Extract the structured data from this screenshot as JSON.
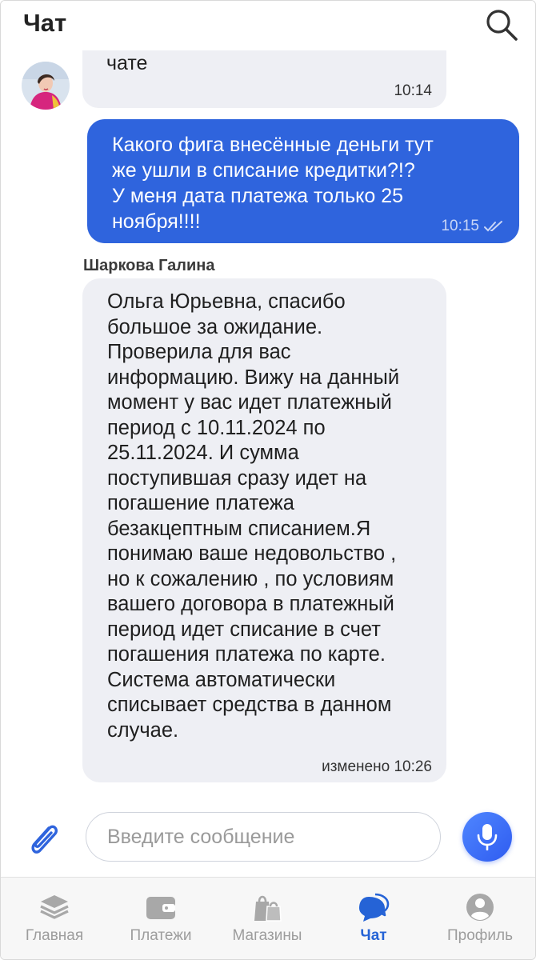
{
  "header": {
    "title": "Чат"
  },
  "messages": {
    "incoming_top": {
      "text": "пожалуйста, оставайтесь в\nчате",
      "time": "10:14"
    },
    "outgoing": {
      "text": "Какого фига внесённые деньги тут\nже ушли в списание кредитки?!?\nУ меня дата платежа только 25\nноября!!!!",
      "time": "10:15"
    },
    "incoming": {
      "sender": "Шаркова Галина",
      "text": "Ольга Юрьевна, спасибо\nбольшое за ожидание.\nПроверила для вас\nинформацию. Вижу на данный\nмомент у вас идет платежный\nпериод с 10.11.2024 по\n25.11.2024. И сумма\nпоступившая сразу идет на\nпогашение платежа\nбезакцептным списанием.Я\n понимаю ваше недовольство ,\n но к сожалению , по условиям\n вашего договора в платежный\n период идет списание в счет\n погашения платежа по карте.\n Система автоматически\n списывает средства в данном\n случае.",
      "time": "изменено 10:26"
    }
  },
  "composer": {
    "placeholder": "Введите сообщение"
  },
  "nav": [
    {
      "label": "Главная",
      "icon": "layers-icon"
    },
    {
      "label": "Платежи",
      "icon": "wallet-icon"
    },
    {
      "label": "Магазины",
      "icon": "shopping-bag-icon"
    },
    {
      "label": "Чат",
      "icon": "chat-bubbles-icon",
      "active": true
    },
    {
      "label": "Профиль",
      "icon": "profile-icon"
    }
  ],
  "colors": {
    "accent": "#2f64dd",
    "active_nav": "#2563d6",
    "bubble_in": "#eeeff4"
  }
}
